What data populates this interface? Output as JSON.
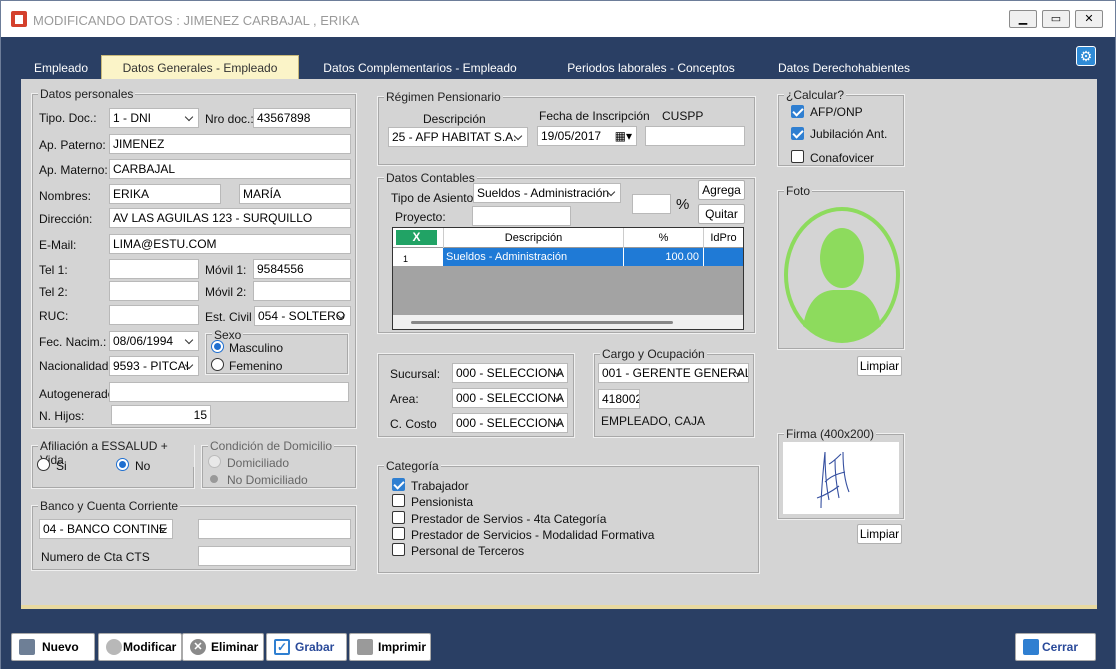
{
  "window": {
    "title": "MODIFICANDO DATOS : JIMENEZ CARBAJAL , ERIKA"
  },
  "tabs": [
    "Empleado",
    "Datos Generales - Empleado",
    "Datos Complementarios - Empleado",
    "Periodos laborales - Conceptos",
    "Datos Derechohabientes"
  ],
  "personales": {
    "legend": "Datos personales",
    "tipo_doc_label": "Tipo. Doc.:",
    "tipo_doc": "1 - DNI",
    "nro_doc_label": "Nro doc.:",
    "nro_doc": "43567898",
    "ap_paterno_label": "Ap. Paterno:",
    "ap_paterno": "JIMENEZ",
    "ap_materno_label": "Ap. Materno:",
    "ap_materno": "CARBAJAL",
    "nombres_label": "Nombres:",
    "nombre1": "ERIKA",
    "nombre2": "MARÍA",
    "direccion_label": "Dirección:",
    "direccion": "AV LAS AGUILAS 123 - SURQUILLO",
    "email_label": "E-Mail:",
    "email": "LIMA@ESTU.COM",
    "tel1_label": "Tel 1:",
    "tel1": "",
    "movil1_label": "Móvil 1:",
    "movil1": "9584556",
    "tel2_label": "Tel 2:",
    "tel2": "",
    "movil2_label": "Móvil 2:",
    "movil2": "",
    "ruc_label": "RUC:",
    "ruc": "",
    "est_civil_label": "Est. Civil",
    "est_civil": "054 - SOLTERO",
    "fec_nacim_label": "Fec. Nacim.:",
    "fec_nacim": "08/06/1994",
    "sexo_legend": "Sexo",
    "sexo_masc": "Masculino",
    "sexo_fem": "Femenino",
    "nacionalidad_label": "Nacionalidad:",
    "nacionalidad": "9593 - PITCAI",
    "autogenerado_label": "Autogenerado:",
    "autogenerado": "",
    "hijos_label": "N. Hijos:",
    "hijos": "15"
  },
  "essalud": {
    "legend": "Afiliación a ESSALUD + Vida",
    "si": "Si",
    "no": "No"
  },
  "domicilio": {
    "legend": "Condición de Domicilio",
    "opt1": "Domiciliado",
    "opt2": "No Domiciliado"
  },
  "banco": {
    "legend": "Banco y Cuenta Corriente",
    "banco": "04 - BANCO CONTINE",
    "cuenta": "",
    "cts_label": "Numero de Cta CTS",
    "cts": ""
  },
  "pension": {
    "legend": "Régimen Pensionario",
    "desc_label": "Descripción",
    "desc": "25 - AFP HABITAT S.A.",
    "fecha_label": "Fecha de Inscripción",
    "fecha": "19/05/2017",
    "cuspp_label": "CUSPP",
    "cuspp": ""
  },
  "contables": {
    "legend": "Datos Contables",
    "asiento_label": "Tipo de Asiento:",
    "asiento": "Sueldos - Administración",
    "pct": "",
    "pct_sym": "%",
    "proyecto_label": "Proyecto:",
    "proyecto": "",
    "agrega": "Agrega",
    "quitar": "Quitar",
    "grid_headers": [
      "X",
      "Descripción",
      "%",
      "IdPro"
    ],
    "row": {
      "n": "1",
      "desc": "Sueldos - Administración",
      "pct": "100.00"
    }
  },
  "calc": {
    "legend": "¿Calcular?",
    "afp": "AFP/ONP",
    "jub": "Jubilación Ant.",
    "conaf": "Conafovicer"
  },
  "foto": {
    "legend": "Foto",
    "limpiar": "Limpiar"
  },
  "firma": {
    "legend": "Firma (400x200)",
    "limpiar": "Limpiar"
  },
  "ubic": {
    "sucursal_label": "Sucursal:",
    "sucursal": "000 - SELECCIONA",
    "area_label": "Area:",
    "area": "000 - SELECCIONA",
    "costo_label": "C. Costo",
    "costo": "000 - SELECCIONA"
  },
  "cargo": {
    "legend": "Cargo y Ocupación",
    "cargo": "001 - GERENTE GENERAL",
    "code": "418002",
    "ocup": "EMPLEADO, CAJA"
  },
  "categoria": {
    "legend": "Categoría",
    "items": [
      "Trabajador",
      "Pensionista",
      "Prestador de Servios - 4ta Categoría",
      "Prestador de Servicios - Modalidad Formativa",
      "Personal de Terceros"
    ]
  },
  "toolbar": {
    "nuevo": "Nuevo",
    "modificar": "Modificar",
    "eliminar": "Eliminar",
    "grabar": "Grabar",
    "imprimir": "Imprimir",
    "cerrar": "Cerrar"
  },
  "colors": {
    "frame": "#2a3f64",
    "panel": "#d4d4d4",
    "accent": "#2f7fd1",
    "photo": "#8ddb5d"
  }
}
